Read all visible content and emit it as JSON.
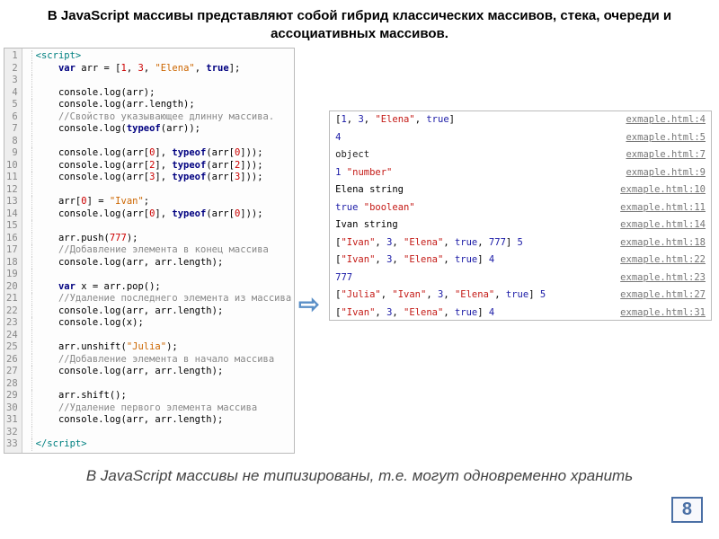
{
  "title": "В JavaScript массивы представляют собой гибрид классических массивов, стека, очереди и ассоциативных массивов.",
  "code": {
    "lines": [
      {
        "n": 1,
        "html": "<span class='tag'>&lt;script&gt;</span>"
      },
      {
        "n": 2,
        "html": "    <span class='kw'>var</span> arr = [<span class='num'>1</span>, <span class='num'>3</span>, <span class='str'>\"Elena\"</span>, <span class='boolv'>true</span>];"
      },
      {
        "n": 3,
        "html": ""
      },
      {
        "n": 4,
        "html": "    console.log(arr);"
      },
      {
        "n": 5,
        "html": "    console.log(arr.length);"
      },
      {
        "n": 6,
        "html": "    <span class='cmt'>//Свойство указывающее длинну массива.</span>"
      },
      {
        "n": 7,
        "html": "    console.log(<span class='kw'>typeof</span>(arr));"
      },
      {
        "n": 8,
        "html": ""
      },
      {
        "n": 9,
        "html": "    console.log(arr[<span class='num'>0</span>], <span class='kw'>typeof</span>(arr[<span class='num'>0</span>]));"
      },
      {
        "n": 10,
        "html": "    console.log(arr[<span class='num'>2</span>], <span class='kw'>typeof</span>(arr[<span class='num'>2</span>]));"
      },
      {
        "n": 11,
        "html": "    console.log(arr[<span class='num'>3</span>], <span class='kw'>typeof</span>(arr[<span class='num'>3</span>]));"
      },
      {
        "n": 12,
        "html": ""
      },
      {
        "n": 13,
        "html": "    arr[<span class='num'>0</span>] = <span class='str'>\"Ivan\"</span>;"
      },
      {
        "n": 14,
        "html": "    console.log(arr[<span class='num'>0</span>], <span class='kw'>typeof</span>(arr[<span class='num'>0</span>]));"
      },
      {
        "n": 15,
        "html": ""
      },
      {
        "n": 16,
        "html": "    arr.push(<span class='num'>777</span>);"
      },
      {
        "n": 17,
        "html": "    <span class='cmt'>//Добавление элемента в конец массива</span>"
      },
      {
        "n": 18,
        "html": "    console.log(arr, arr.length);"
      },
      {
        "n": 19,
        "html": ""
      },
      {
        "n": 20,
        "html": "    <span class='kw'>var</span> x = arr.pop();"
      },
      {
        "n": 21,
        "html": "    <span class='cmt'>//Удаление последнего элемента из массива</span>"
      },
      {
        "n": 22,
        "html": "    console.log(arr, arr.length);"
      },
      {
        "n": 23,
        "html": "    console.log(x);"
      },
      {
        "n": 24,
        "html": ""
      },
      {
        "n": 25,
        "html": "    arr.unshift(<span class='str'>\"Julia\"</span>);"
      },
      {
        "n": 26,
        "html": "    <span class='cmt'>//Добавление элемента в начало массива</span>"
      },
      {
        "n": 27,
        "html": "    console.log(arr, arr.length);"
      },
      {
        "n": 28,
        "html": ""
      },
      {
        "n": 29,
        "html": "    arr.shift();"
      },
      {
        "n": 30,
        "html": "    <span class='cmt'>//Удаление первого элемента массива</span>"
      },
      {
        "n": 31,
        "html": "    console.log(arr, arr.length);"
      },
      {
        "n": 32,
        "html": ""
      },
      {
        "n": 33,
        "html": "<span class='tag'>&lt;/script&gt;</span>"
      }
    ]
  },
  "console": [
    {
      "left": "[<span class='c-num'>1</span>, <span class='c-num'>3</span>, <span class='c-str'>\"Elena\"</span>, <span class='c-bool'>true</span>]",
      "right": "exmaple.html:4"
    },
    {
      "left": "<span class='c-num'>4</span>",
      "right": "exmaple.html:5"
    },
    {
      "left": "<span class='c-obj'>object</span>",
      "right": "exmaple.html:7"
    },
    {
      "left": "<span class='c-num'>1</span> <span class='c-str'>\"number\"</span>",
      "right": "exmaple.html:9"
    },
    {
      "left": "Elena string",
      "right": "exmaple.html:10"
    },
    {
      "left": "<span class='c-bool'>true</span> <span class='c-str'>\"boolean\"</span>",
      "right": "exmaple.html:11"
    },
    {
      "left": "Ivan string",
      "right": "exmaple.html:14"
    },
    {
      "left": "[<span class='c-str'>\"Ivan\"</span>, <span class='c-num'>3</span>, <span class='c-str'>\"Elena\"</span>, <span class='c-bool'>true</span>, <span class='c-num'>777</span>] <span class='c-num'>5</span>",
      "right": "exmaple.html:18"
    },
    {
      "left": "[<span class='c-str'>\"Ivan\"</span>, <span class='c-num'>3</span>, <span class='c-str'>\"Elena\"</span>, <span class='c-bool'>true</span>] <span class='c-num'>4</span>",
      "right": "exmaple.html:22"
    },
    {
      "left": "<span class='c-num'>777</span>",
      "right": "exmaple.html:23"
    },
    {
      "left": "[<span class='c-str'>\"Julia\"</span>, <span class='c-str'>\"Ivan\"</span>, <span class='c-num'>3</span>, <span class='c-str'>\"Elena\"</span>, <span class='c-bool'>true</span>] <span class='c-num'>5</span>",
      "right": "exmaple.html:27"
    },
    {
      "left": "[<span class='c-str'>\"Ivan\"</span>, <span class='c-num'>3</span>, <span class='c-str'>\"Elena\"</span>, <span class='c-bool'>true</span>] <span class='c-num'>4</span>",
      "right": "exmaple.html:31"
    }
  ],
  "arrow": "⇨",
  "footer": "В JavaScript массивы не типизированы, т.е. могут одновременно хранить",
  "page": "8"
}
